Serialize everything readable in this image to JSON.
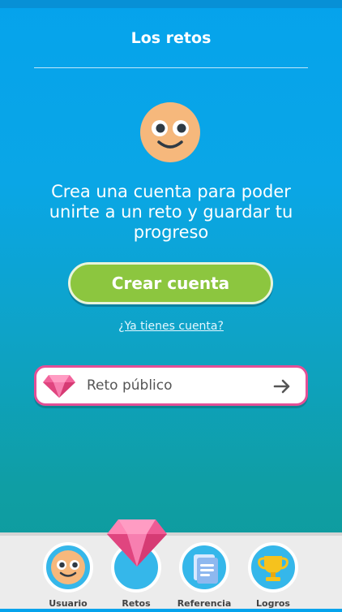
{
  "header": {
    "title": "Los retos"
  },
  "empty_state": {
    "face_icon": "smiley-face-icon",
    "message": "Crea una cuenta para poder unirte a un reto y guardar tu progreso",
    "create_account_label": "Crear cuenta",
    "login_link": "¿Ya tienes cuenta?"
  },
  "public_challenge": {
    "icon": "pink-gem-icon",
    "label": "Reto público",
    "arrow_icon": "arrow-right-icon"
  },
  "tabbar": {
    "tabs": [
      {
        "label": "Usuario",
        "icon": "smiley-face-icon"
      },
      {
        "label": "Retos",
        "icon": "pink-gem-icon",
        "selected": true
      },
      {
        "label": "Referencia",
        "icon": "document-icon"
      },
      {
        "label": "Logros",
        "icon": "trophy-icon"
      }
    ]
  },
  "colors": {
    "background_top": "#05a3ec",
    "background_bottom": "#0e9a9a",
    "primary_button": "#8cc63f",
    "card_border": "#e44f96",
    "tab_circle": "#35b7ea",
    "tabbar": "#ececec"
  }
}
